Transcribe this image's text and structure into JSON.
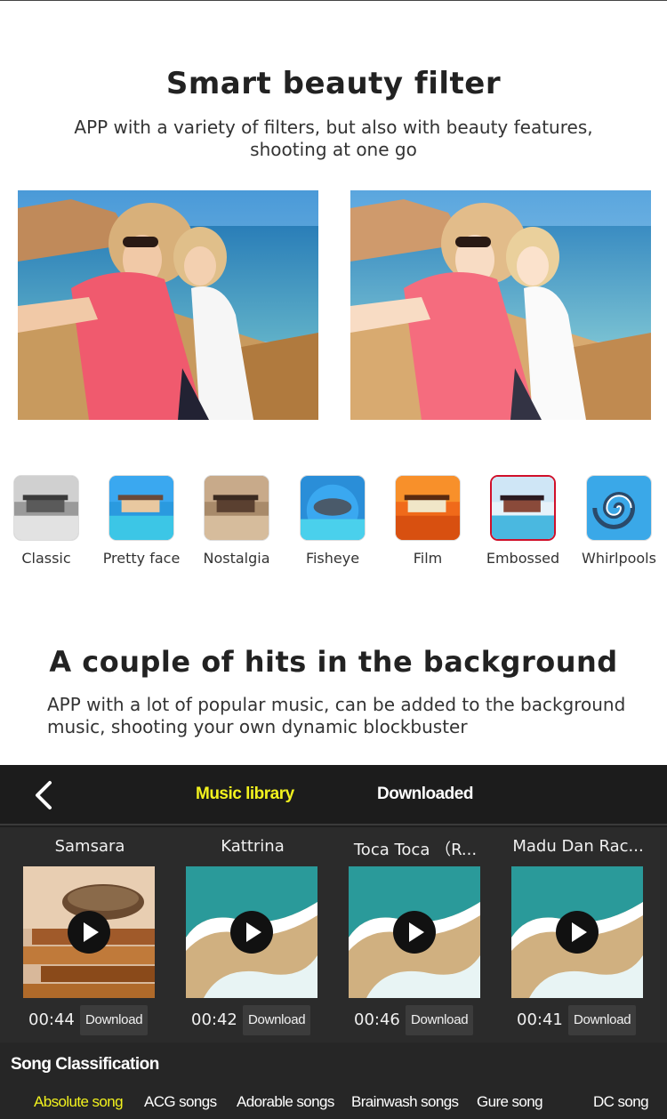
{
  "beauty_section": {
    "title": "Smart beauty filter",
    "description": "APP with a variety of filters, but also with beauty features, shooting at one go"
  },
  "filters": [
    {
      "label": "Classic",
      "icon": "classic-filter-thumbnail"
    },
    {
      "label": "Pretty face",
      "icon": "pretty-face-filter-thumbnail"
    },
    {
      "label": "Nostalgia",
      "icon": "nostalgia-filter-thumbnail"
    },
    {
      "label": "Fisheye",
      "icon": "fisheye-filter-thumbnail"
    },
    {
      "label": "Film",
      "icon": "film-filter-thumbnail"
    },
    {
      "label": "Embossed",
      "icon": "embossed-filter-thumbnail",
      "selected": true
    },
    {
      "label": "Whirlpools",
      "icon": "whirlpools-filter-thumbnail"
    }
  ],
  "music_section": {
    "title": "A couple of hits in the background",
    "description": "APP with a lot of popular music, can be added to the background music, shooting your own dynamic blockbuster"
  },
  "music_app": {
    "back_icon": "chevron-left-icon",
    "tabs": {
      "library": "Music library",
      "downloaded": "Downloaded"
    },
    "active_tab": "Music library",
    "songs": [
      {
        "title": "Samsara",
        "duration": "00:44",
        "download_label": "Download",
        "cover": "books-cover"
      },
      {
        "title": "Kattrina",
        "duration": "00:42",
        "download_label": "Download",
        "cover": "beach-cover"
      },
      {
        "title": "Toca Toca （R...",
        "duration": "00:46",
        "download_label": "Download",
        "cover": "beach-cover"
      },
      {
        "title": "Madu Dan Rac...",
        "duration": "00:41",
        "download_label": "Download",
        "cover": "beach-cover"
      }
    ],
    "classification_title": "Song Classification",
    "categories": [
      "Absolute song",
      "ACG songs",
      "Adorable songs",
      "Brainwash songs",
      "Gure song",
      "DC song"
    ],
    "active_category": "Absolute song"
  },
  "colors": {
    "accent_yellow": "#f2f21e",
    "selected_filter_border": "#d0102a",
    "panel_dark": "#1e1e1e"
  }
}
